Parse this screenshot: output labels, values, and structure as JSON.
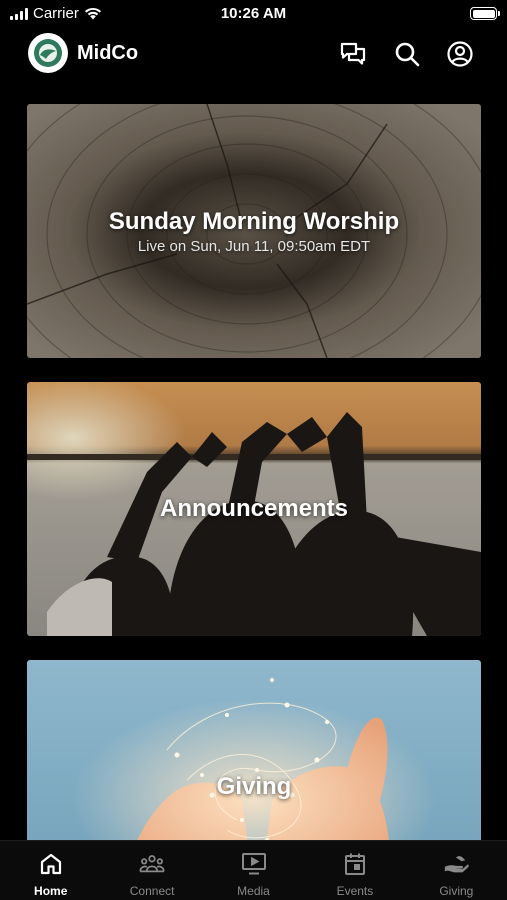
{
  "status_bar": {
    "carrier": "Carrier",
    "time": "10:26 AM"
  },
  "header": {
    "title": "MidCo",
    "icons": [
      "logo-icon",
      "chat-icon",
      "search-icon",
      "profile-icon"
    ]
  },
  "cards": [
    {
      "title": "Sunday Morning Worship",
      "subtitle": "Live on Sun, Jun 11, 09:50am EDT"
    },
    {
      "title": "Announcements"
    },
    {
      "title": "Giving"
    }
  ],
  "tabs": [
    {
      "label": "Home",
      "icon": "home-icon",
      "active": true
    },
    {
      "label": "Connect",
      "icon": "people-icon",
      "active": false
    },
    {
      "label": "Media",
      "icon": "play-screen-icon",
      "active": false
    },
    {
      "label": "Events",
      "icon": "calendar-icon",
      "active": false
    },
    {
      "label": "Giving",
      "icon": "giving-hand-icon",
      "active": false
    }
  ],
  "colors": {
    "background": "#000000",
    "tab_active": "#ffffff",
    "tab_inactive": "#8a8a8a",
    "logo_green": "#2f7a5c"
  }
}
